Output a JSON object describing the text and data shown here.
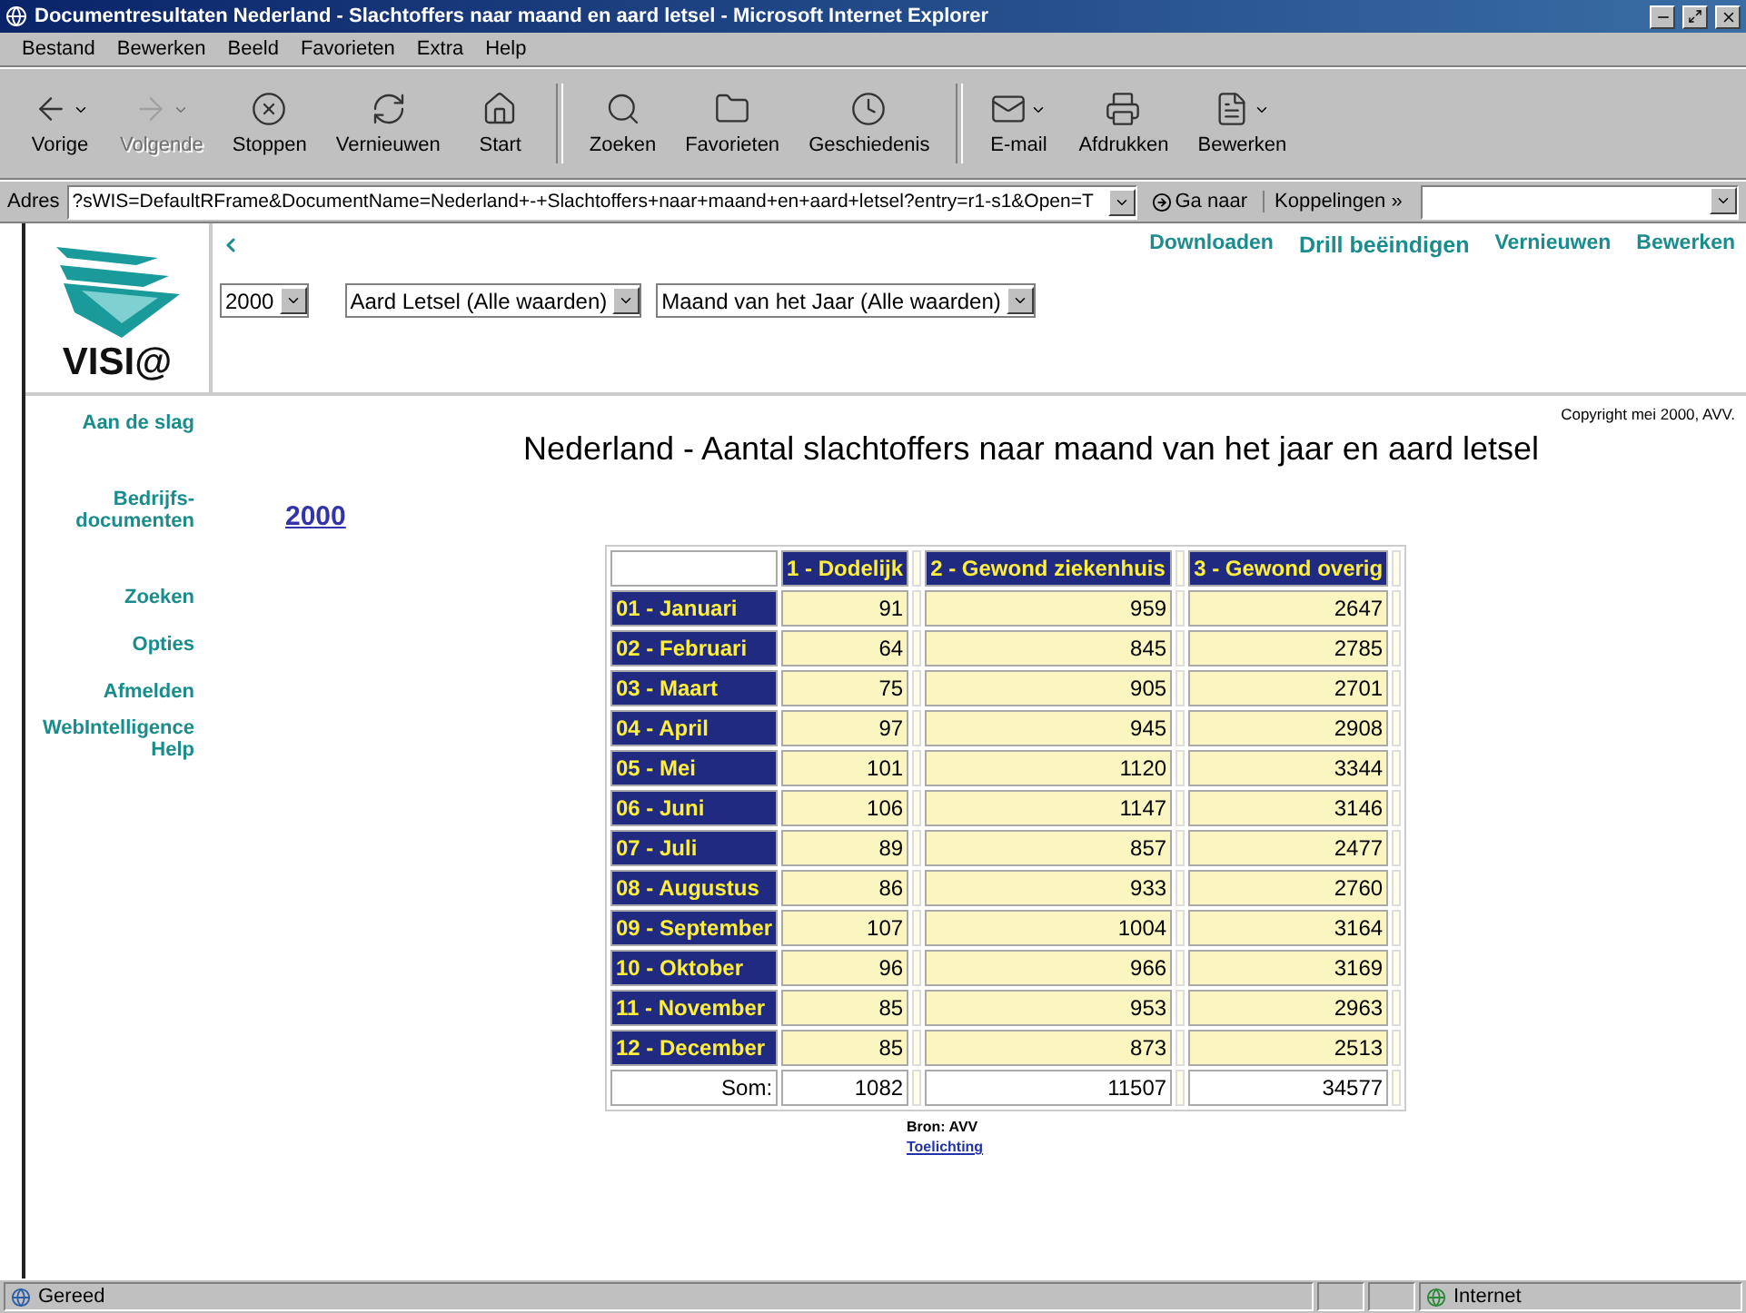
{
  "window": {
    "title": "Documentresultaten Nederland - Slachtoffers naar maand en aard letsel - Microsoft Internet Explorer"
  },
  "menu": [
    "Bestand",
    "Bewerken",
    "Beeld",
    "Favorieten",
    "Extra",
    "Help"
  ],
  "toolbar": [
    {
      "kind": "back",
      "label": "Vorige",
      "disabled": false,
      "dropdown": true
    },
    {
      "kind": "forward",
      "label": "Volgende",
      "disabled": true,
      "dropdown": true
    },
    {
      "kind": "stop",
      "label": "Stoppen",
      "disabled": false,
      "dropdown": false
    },
    {
      "kind": "refresh",
      "label": "Vernieuwen",
      "disabled": false,
      "dropdown": false
    },
    {
      "kind": "home",
      "label": "Start",
      "disabled": false,
      "dropdown": false,
      "separator_after": true
    },
    {
      "kind": "search",
      "label": "Zoeken",
      "disabled": false,
      "dropdown": false
    },
    {
      "kind": "favorites",
      "label": "Favorieten",
      "disabled": false,
      "dropdown": false
    },
    {
      "kind": "history",
      "label": "Geschiedenis",
      "disabled": false,
      "dropdown": false,
      "separator_after": true
    },
    {
      "kind": "mail",
      "label": "E-mail",
      "disabled": false,
      "dropdown": true
    },
    {
      "kind": "print",
      "label": "Afdrukken",
      "disabled": false,
      "dropdown": false
    },
    {
      "kind": "edit",
      "label": "Bewerken",
      "disabled": false,
      "dropdown": true
    }
  ],
  "address": {
    "label": "Adres",
    "value": "?sWIS=DefaultRFrame&DocumentName=Nederland+-+Slachtoffers+naar+maand+en+aard+letsel?entry=r1-s1&Open=T",
    "go": "Ga naar",
    "links": "Koppelingen »"
  },
  "logo": {
    "text": "VISI@"
  },
  "header_links": [
    "Downloaden",
    "Drill beëindigen",
    "Vernieuwen",
    "Bewerken"
  ],
  "filters": [
    "2000",
    "Aard Letsel (Alle waarden)",
    "Maand van het Jaar (Alle waarden)"
  ],
  "sidebar": {
    "items": [
      "Aan de slag",
      "Bedrijfs-documenten",
      "Zoeken",
      "Opties",
      "Afmelden",
      "WebIntelligence Help"
    ]
  },
  "copyright": "Copyright mei 2000, AVV.",
  "report": {
    "title": "Nederland - Aantal slachtoffers naar maand van het jaar en aard letsel",
    "section": "2000",
    "table": {
      "columns": [
        "1 - Dodelijk",
        "2 - Gewond ziekenhuis",
        "3 - Gewond overig"
      ],
      "rows": [
        {
          "label": "01 - Januari",
          "values": [
            "91",
            "959",
            "2647"
          ]
        },
        {
          "label": "02 - Februari",
          "values": [
            "64",
            "845",
            "2785"
          ]
        },
        {
          "label": "03 - Maart",
          "values": [
            "75",
            "905",
            "2701"
          ]
        },
        {
          "label": "04 - April",
          "values": [
            "97",
            "945",
            "2908"
          ]
        },
        {
          "label": "05 - Mei",
          "values": [
            "101",
            "1120",
            "3344"
          ]
        },
        {
          "label": "06 - Juni",
          "values": [
            "106",
            "1147",
            "3146"
          ]
        },
        {
          "label": "07 - Juli",
          "values": [
            "89",
            "857",
            "2477"
          ]
        },
        {
          "label": "08 - Augustus",
          "values": [
            "86",
            "933",
            "2760"
          ]
        },
        {
          "label": "09 - September",
          "values": [
            "107",
            "1004",
            "3164"
          ]
        },
        {
          "label": "10 - Oktober",
          "values": [
            "96",
            "966",
            "3169"
          ]
        },
        {
          "label": "11 - November",
          "values": [
            "85",
            "953",
            "2963"
          ]
        },
        {
          "label": "12 - December",
          "values": [
            "85",
            "873",
            "2513"
          ]
        }
      ],
      "total": {
        "label": "Som:",
        "values": [
          "1082",
          "11507",
          "34577"
        ]
      }
    },
    "source": "Bron: AVV",
    "link": "Toelichting"
  },
  "status_bar": {
    "text": "Gereed",
    "zone": "Internet"
  }
}
